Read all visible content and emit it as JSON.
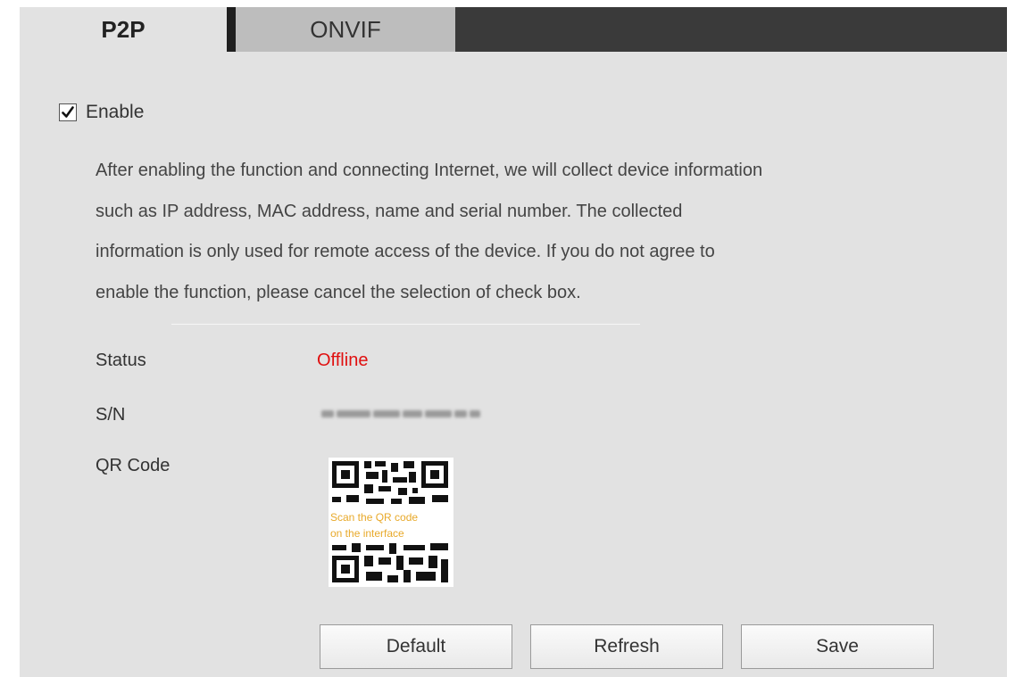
{
  "tabs": [
    {
      "label": "P2P",
      "active": true
    },
    {
      "label": "ONVIF",
      "active": false
    }
  ],
  "enable": {
    "label": "Enable",
    "checked": true
  },
  "description": [
    "After enabling the function and connecting Internet, we will collect device information",
    "such as IP address, MAC address, name and serial number. The collected",
    "information is only used for remote access of the device. If you do not agree to",
    "enable the function, please cancel the selection of check box."
  ],
  "fields": {
    "status_label": "Status",
    "status_value": "Offline",
    "sn_label": "S/N",
    "qr_label": "QR Code"
  },
  "qr": {
    "line1": "Scan the QR code",
    "line2": "on the interface"
  },
  "buttons": {
    "default": "Default",
    "refresh": "Refresh",
    "save": "Save"
  },
  "colors": {
    "status_offline": "#e01010",
    "qr_text": "#e8a92a",
    "panel_bg": "#e2e2e2",
    "tabbar_bg": "#3a3a3a"
  }
}
